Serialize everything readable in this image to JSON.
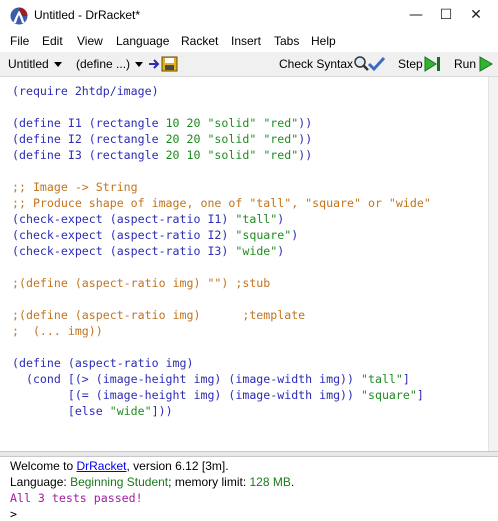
{
  "window": {
    "title": "Untitled - DrRacket*",
    "minimize": "—",
    "maximize": "☐",
    "close": "✕"
  },
  "menu": [
    "File",
    "Edit",
    "View",
    "Language",
    "Racket",
    "Insert",
    "Tabs",
    "Help"
  ],
  "toolbar": {
    "file_dropdown": "Untitled",
    "define_dropdown": "(define ...)",
    "check_syntax": "Check Syntax",
    "step": "Step",
    "run": "Run"
  },
  "colors": {
    "keyword": "#2c2cb5",
    "number": "#1a8a1a",
    "string": "#228b22",
    "comment": "#c2741f",
    "passed": "#a020a0",
    "link": "#0000ee",
    "info": "#1a7a1a"
  },
  "code_lines": [
    [
      {
        "t": "(require 2htdp/image)",
        "c": "k"
      }
    ],
    [],
    [
      {
        "t": "(define I1 (rectangle ",
        "c": "k"
      },
      {
        "t": "10 20",
        "c": "n"
      },
      {
        "t": " ",
        "c": "k"
      },
      {
        "t": "\"solid\"",
        "c": "s"
      },
      {
        "t": " ",
        "c": "k"
      },
      {
        "t": "\"red\"",
        "c": "s"
      },
      {
        "t": "))",
        "c": "k"
      }
    ],
    [
      {
        "t": "(define I2 (rectangle ",
        "c": "k"
      },
      {
        "t": "20 20",
        "c": "n"
      },
      {
        "t": " ",
        "c": "k"
      },
      {
        "t": "\"solid\"",
        "c": "s"
      },
      {
        "t": " ",
        "c": "k"
      },
      {
        "t": "\"red\"",
        "c": "s"
      },
      {
        "t": "))",
        "c": "k"
      }
    ],
    [
      {
        "t": "(define I3 (rectangle ",
        "c": "k"
      },
      {
        "t": "20 10",
        "c": "n"
      },
      {
        "t": " ",
        "c": "k"
      },
      {
        "t": "\"solid\"",
        "c": "s"
      },
      {
        "t": " ",
        "c": "k"
      },
      {
        "t": "\"red\"",
        "c": "s"
      },
      {
        "t": "))",
        "c": "k"
      }
    ],
    [],
    [
      {
        "t": ";; Image -> String",
        "c": "c"
      }
    ],
    [
      {
        "t": ";; Produce shape of image, one of \"tall\", \"square\" or \"wide\"",
        "c": "c"
      }
    ],
    [
      {
        "t": "(check-expect (aspect-ratio I1) ",
        "c": "k"
      },
      {
        "t": "\"tall\"",
        "c": "s"
      },
      {
        "t": ")",
        "c": "k"
      }
    ],
    [
      {
        "t": "(check-expect (aspect-ratio I2) ",
        "c": "k"
      },
      {
        "t": "\"square\"",
        "c": "s"
      },
      {
        "t": ")",
        "c": "k"
      }
    ],
    [
      {
        "t": "(check-expect (aspect-ratio I3) ",
        "c": "k"
      },
      {
        "t": "\"wide\"",
        "c": "s"
      },
      {
        "t": ")",
        "c": "k"
      }
    ],
    [],
    [
      {
        "t": ";(define (aspect-ratio img) \"\") ;stub",
        "c": "c"
      }
    ],
    [],
    [
      {
        "t": ";(define (aspect-ratio img)      ;template",
        "c": "c"
      }
    ],
    [
      {
        "t": ";  (... img))",
        "c": "c"
      }
    ],
    [],
    [
      {
        "t": "(define (aspect-ratio img)",
        "c": "k"
      }
    ],
    [
      {
        "t": "  (cond [(> (image-height img) (image-width img)) ",
        "c": "k"
      },
      {
        "t": "\"tall\"",
        "c": "s"
      },
      {
        "t": "]",
        "c": "k"
      }
    ],
    [
      {
        "t": "        [(= (image-height img) (image-width img)) ",
        "c": "k"
      },
      {
        "t": "\"square\"",
        "c": "s"
      },
      {
        "t": "]",
        "c": "k"
      }
    ],
    [
      {
        "t": "        [else ",
        "c": "k"
      },
      {
        "t": "\"wide\"",
        "c": "s"
      },
      {
        "t": "]))",
        "c": "k"
      }
    ]
  ],
  "repl": {
    "welcome_prefix": "Welcome to ",
    "welcome_link": "DrRacket",
    "welcome_suffix": ", version 6.12 [3m].",
    "language_prefix": "Language: ",
    "language_name": "Beginning Student",
    "language_middle": "; memory limit: ",
    "memory": "128 MB",
    "language_end": ".",
    "result": "All 3 tests passed!",
    "prompt": ">"
  }
}
